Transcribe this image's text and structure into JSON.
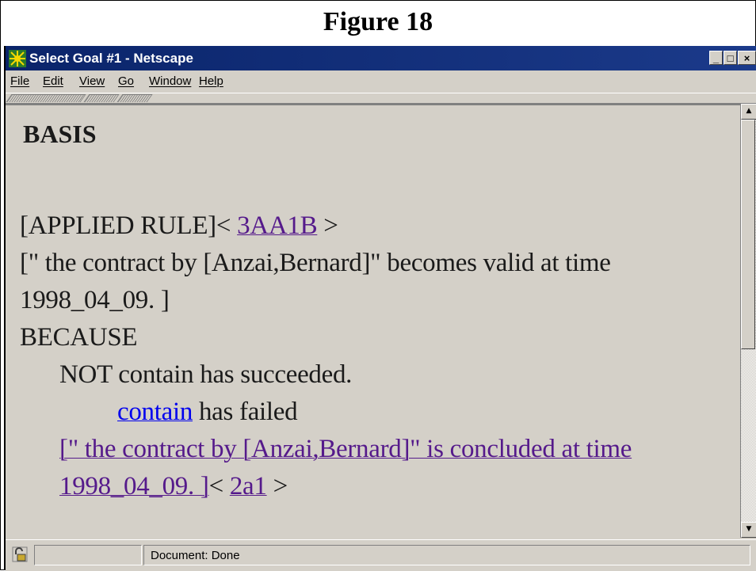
{
  "figure": {
    "title": "Figure 18"
  },
  "window": {
    "title": "Select Goal #1 - Netscape",
    "controls": {
      "minimize": "_",
      "maximize": "□",
      "close": "×"
    }
  },
  "menu": [
    "File",
    "Edit",
    "View",
    "Go",
    "Window",
    "Help"
  ],
  "content": {
    "heading": "BASIS",
    "applied_rule_label": "[APPLIED RULE]<",
    "applied_rule_link": "3AA1B",
    "applied_rule_close": ">",
    "statement_line1": "[\" the contract by [Anzai,Bernard]\" becomes valid at time",
    "statement_line2": "1998_04_09. ]",
    "because": "BECAUSE",
    "not_contain": "NOT contain has succeeded.",
    "contain_link": "contain",
    "contain_suffix": " has failed",
    "concluded_line1": "[\" the contract by [Anzai,Bernard]\" is concluded at time",
    "concluded_line2": "1998_04_09. ]",
    "rule2_open": "<",
    "rule2_link": "2a1",
    "rule2_close": ">"
  },
  "status": {
    "text": "Document: Done"
  },
  "icons": {
    "app": "netscape-logo-icon",
    "security": "security-lock-icon",
    "scroll_up": "scroll-up-arrow-icon",
    "scroll_down": "scroll-down-arrow-icon"
  },
  "colors": {
    "titlebar": "#0a246a",
    "chrome": "#d4d0c8",
    "visited_link": "#551a8b",
    "link": "#0000ee"
  }
}
